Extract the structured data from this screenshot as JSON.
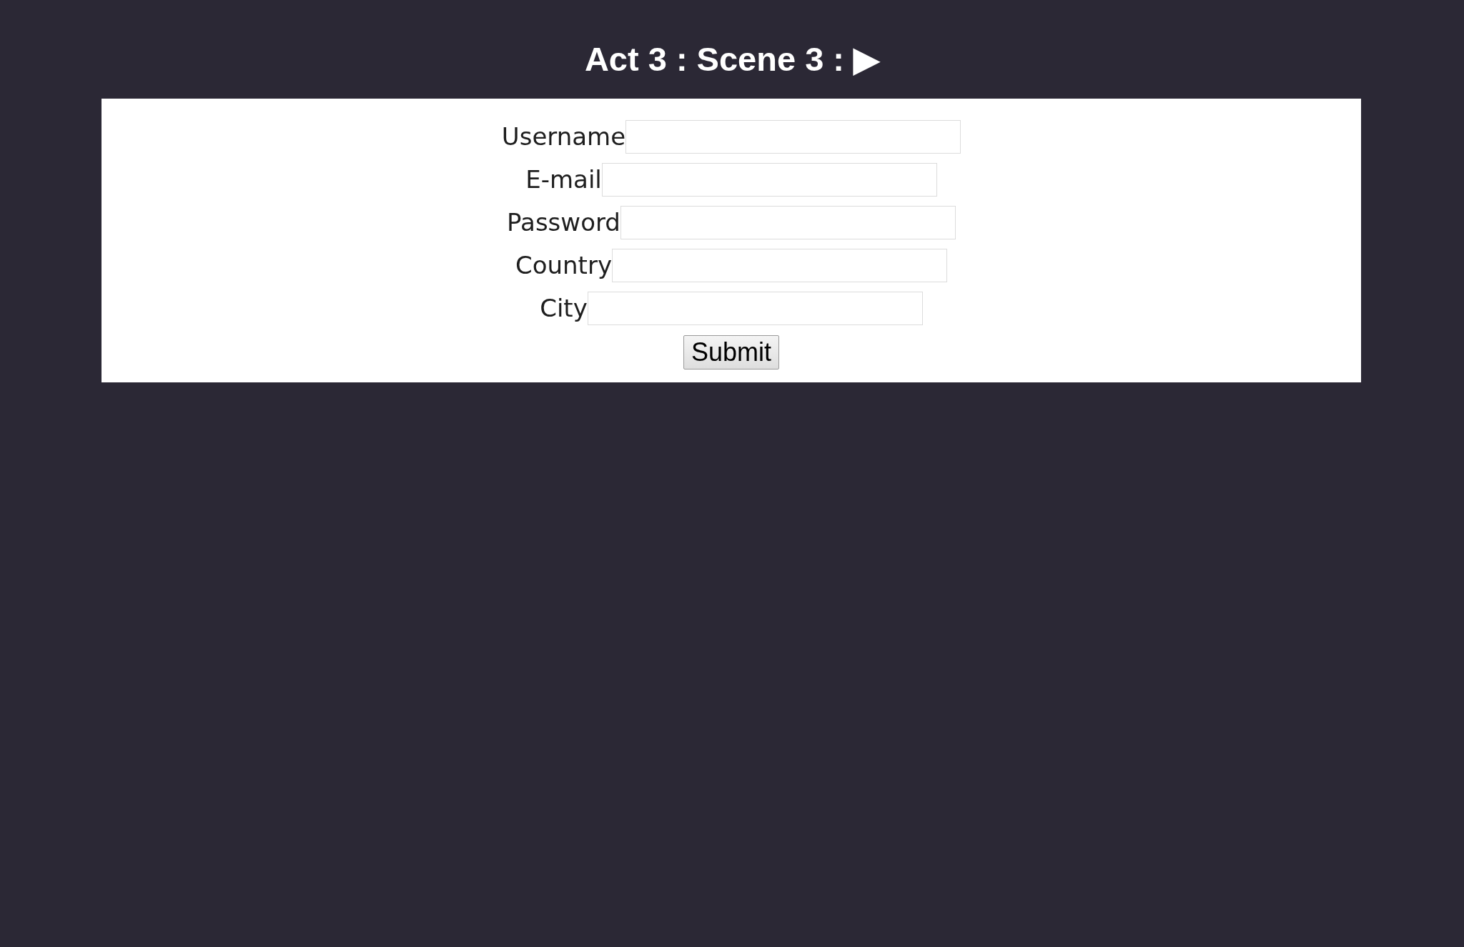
{
  "title": "Act 3 : Scene 3 : ▶",
  "form": {
    "fields": [
      {
        "label": "Username"
      },
      {
        "label": "E-mail"
      },
      {
        "label": "Password"
      },
      {
        "label": "Country"
      },
      {
        "label": "City"
      }
    ],
    "submit": "Submit"
  }
}
